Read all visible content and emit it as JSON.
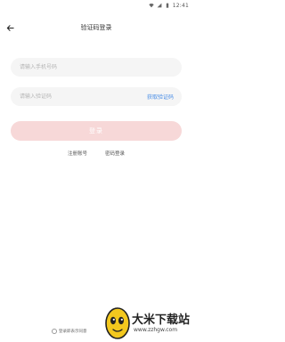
{
  "status_bar": {
    "time": "12:41",
    "icons": [
      "wifi-icon",
      "signal-icon",
      "battery-icon"
    ]
  },
  "header": {
    "back_icon": "back-arrow-icon",
    "title": "验证码登录"
  },
  "form": {
    "phone": {
      "placeholder": "请输入手机号码",
      "value": ""
    },
    "code": {
      "placeholder": "请输入验证码",
      "value": "",
      "get_code_label": "获取验证码"
    },
    "login_label": "登录"
  },
  "links": {
    "register": "注册账号",
    "password_login": "密码登录"
  },
  "agreement": {
    "text": "登录即表示同意"
  },
  "watermark": {
    "title": "大米下载站",
    "url": "www.zzhgw.com"
  },
  "colors": {
    "accent_link": "#4a8ee6",
    "login_button": "#f7d8d8",
    "field_bg": "#f5f5f5"
  }
}
